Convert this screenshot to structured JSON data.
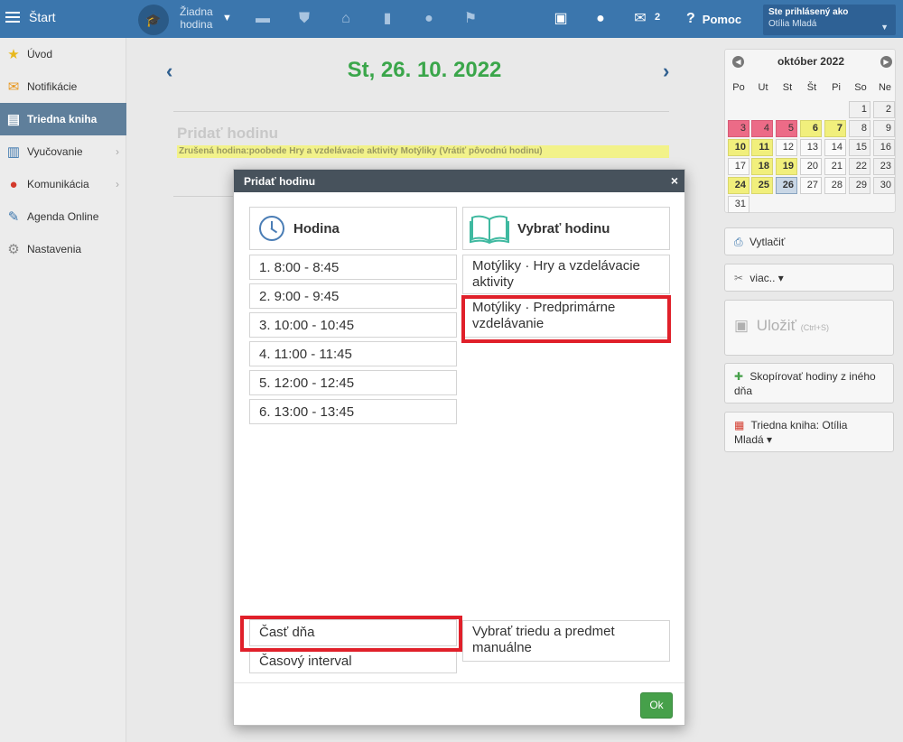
{
  "topbar": {
    "start_label": "Štart",
    "lesson_line1": "Žiadna",
    "lesson_line2": "hodina",
    "messages_count": "2",
    "help_label": "Pomoc",
    "user_title": "Ste prihlásený ako",
    "user_name": "Otília Mladá",
    "icons": [
      "mortarboard-icon",
      "briefcase-icon",
      "shield-icon",
      "bank-icon",
      "bar-chart-icon",
      "circle-icon",
      "people-icon",
      "cast-icon",
      "chat-icon",
      "envelope-icon",
      "help-icon"
    ]
  },
  "sidebar": {
    "items": [
      {
        "label": "Úvod",
        "icon": "star-icon"
      },
      {
        "label": "Notifikácie",
        "icon": "envelope-icon"
      },
      {
        "label": "Triedna kniha",
        "icon": "notebook-icon",
        "active": true
      },
      {
        "label": "Vyučovanie",
        "icon": "book-icon"
      },
      {
        "label": "Komunikácia",
        "icon": "chat-icon"
      },
      {
        "label": "Agenda Online",
        "icon": "pen-icon"
      },
      {
        "label": "Nastavenia",
        "icon": "gear-icon"
      }
    ]
  },
  "main": {
    "date_title": "St, 26. 10. 2022",
    "add_lesson_title": "Pridať hodinu",
    "cancelled_line": "Zrušená hodina:poobede  Hry a vzdelávacie aktivity  Motýliky  (Vrátiť pôvodnú hodinu)"
  },
  "calendar": {
    "month_label": "október 2022",
    "dow": [
      "Po",
      "Ut",
      "St",
      "Št",
      "Pi",
      "So",
      "Ne"
    ],
    "days": [
      "1",
      "2",
      "3",
      "4",
      "5",
      "6",
      "7",
      "8",
      "9",
      "10",
      "11",
      "12",
      "13",
      "14",
      "15",
      "16",
      "17",
      "18",
      "19",
      "20",
      "21",
      "22",
      "23",
      "24",
      "25",
      "26",
      "27",
      "28",
      "29",
      "30",
      "31"
    ],
    "today": "26",
    "colors": {
      "pink": "#ec6b87",
      "yellow": "#f1ef7c",
      "today": "#c9d7e6"
    }
  },
  "right_actions": {
    "print": "Vytlačiť",
    "more": "viac.. ▾",
    "save": "Uložiť",
    "save_hint": "(Ctrl+S)",
    "copy": "Skopírovať hodiny z iného dňa",
    "book_line1": "Triedna kniha: Otília",
    "book_line2": "Mladá ▾"
  },
  "modal": {
    "title": "Pridať hodinu",
    "close": "×",
    "col_hodina": "Hodina",
    "col_vybrat": "Vybrať hodinu",
    "slots": [
      "1. 8:00 - 8:45",
      "2. 9:00 - 9:45",
      "3. 10:00 - 10:45",
      "4. 11:00 - 11:45",
      "5. 12:00 - 12:45",
      "6. 13:00 - 13:45"
    ],
    "subjects": [
      {
        "line1": "Motýliky · Hry a vzdelávacie",
        "line2": "aktivity"
      },
      {
        "line1": "Motýliky · Predprimárne",
        "line2": "vzdelávanie"
      }
    ],
    "part_of_day": "Časť dňa",
    "time_interval": "Časový interval",
    "manual_line1": "Vybrať triedu a predmet",
    "manual_line2": "manuálne",
    "ok": "Ok"
  }
}
